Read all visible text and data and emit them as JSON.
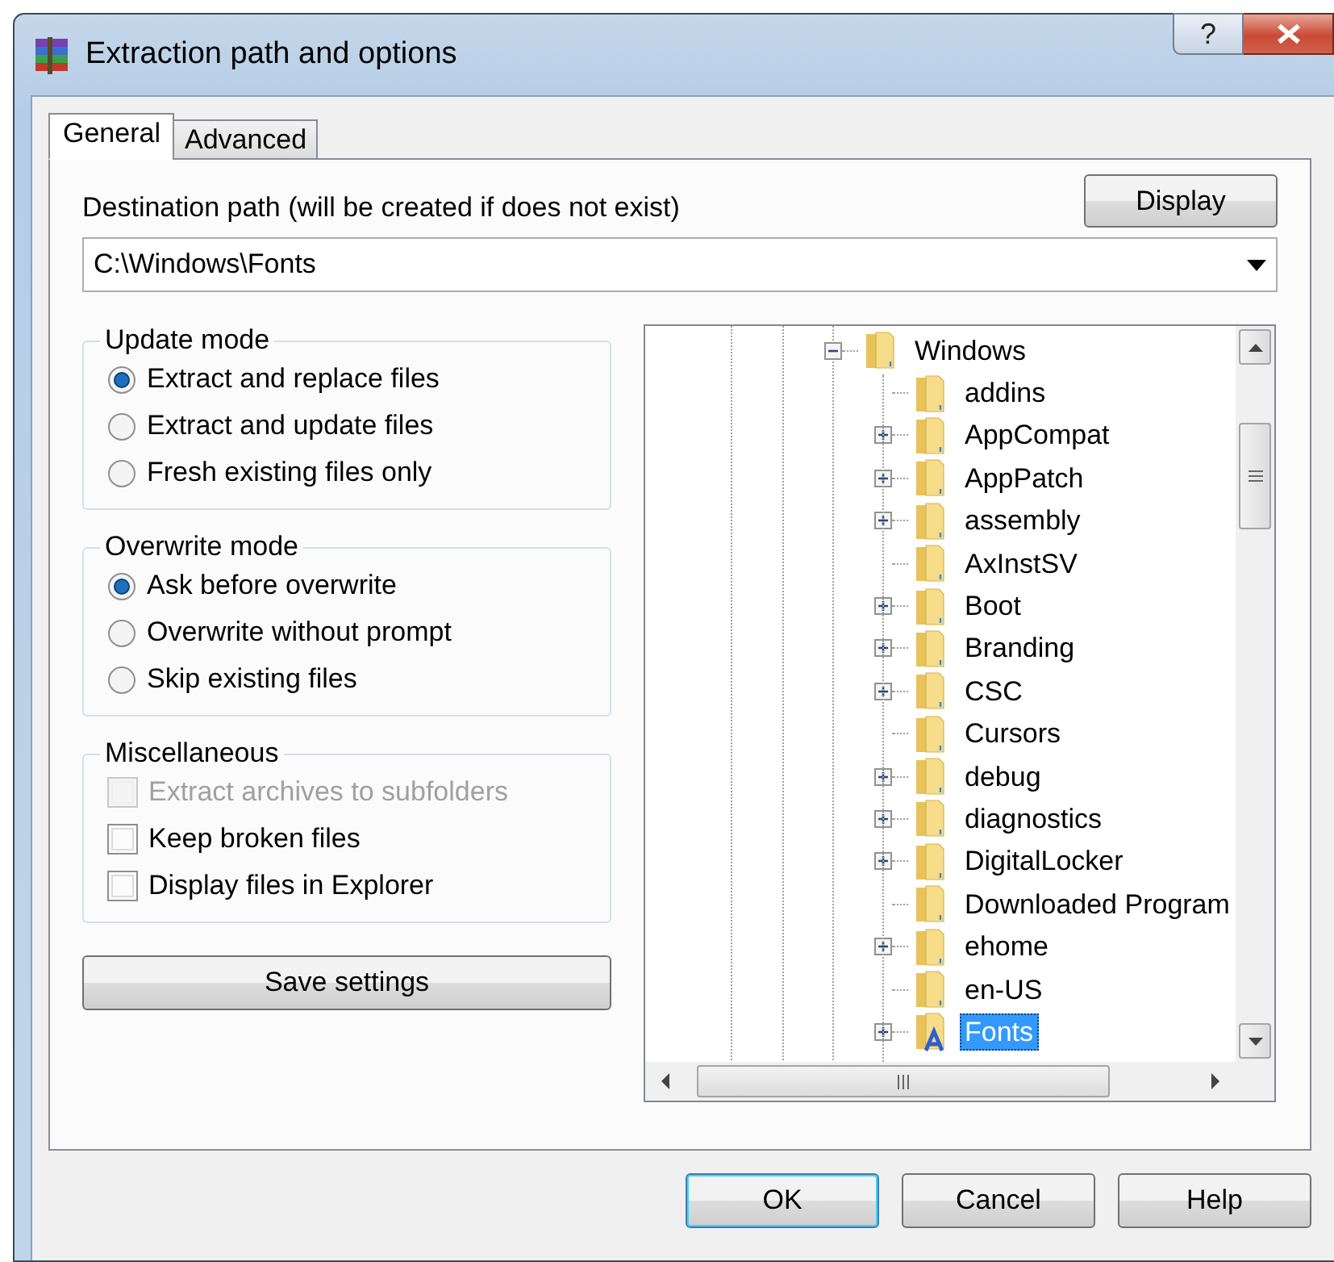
{
  "window": {
    "title": "Extraction path and options",
    "help_glyph": "?"
  },
  "tabs": [
    {
      "label": "General",
      "selected": true
    },
    {
      "label": "Advanced",
      "selected": false
    }
  ],
  "destination": {
    "label": "Destination path (will be created if does not exist)",
    "value": "C:\\Windows\\Fonts",
    "button": "Display"
  },
  "groups": [
    {
      "title": "Update mode",
      "kind": "radio",
      "options": [
        {
          "label": "Extract and replace files",
          "selected": true
        },
        {
          "label": "Extract and update files",
          "selected": false
        },
        {
          "label": "Fresh existing files only",
          "selected": false
        }
      ]
    },
    {
      "title": "Overwrite mode",
      "kind": "radio",
      "options": [
        {
          "label": "Ask before overwrite",
          "selected": true
        },
        {
          "label": "Overwrite without prompt",
          "selected": false
        },
        {
          "label": "Skip existing files",
          "selected": false
        }
      ]
    },
    {
      "title": "Miscellaneous",
      "kind": "checkbox",
      "options": [
        {
          "label": "Extract archives to subfolders",
          "checked": false,
          "disabled": true
        },
        {
          "label": "Keep broken files",
          "checked": false,
          "disabled": false
        },
        {
          "label": "Display files in Explorer",
          "checked": false,
          "disabled": false
        }
      ]
    }
  ],
  "save_button": "Save settings",
  "tree": {
    "nodes": [
      {
        "label": "Windows",
        "kind": "folder",
        "expanded": true,
        "selected": false,
        "children": [
          {
            "label": "addins",
            "kind": "folder",
            "expandable": false,
            "selected": false
          },
          {
            "label": "AppCompat",
            "kind": "folder",
            "expandable": true,
            "selected": false
          },
          {
            "label": "AppPatch",
            "kind": "folder",
            "expandable": true,
            "selected": false
          },
          {
            "label": "assembly",
            "kind": "folder",
            "expandable": true,
            "selected": false
          },
          {
            "label": "AxInstSV",
            "kind": "folder",
            "expandable": false,
            "selected": false
          },
          {
            "label": "Boot",
            "kind": "folder",
            "expandable": true,
            "selected": false
          },
          {
            "label": "Branding",
            "kind": "folder",
            "expandable": true,
            "selected": false
          },
          {
            "label": "CSC",
            "kind": "folder",
            "expandable": true,
            "selected": false
          },
          {
            "label": "Cursors",
            "kind": "folder",
            "expandable": false,
            "selected": false
          },
          {
            "label": "debug",
            "kind": "folder",
            "expandable": true,
            "selected": false
          },
          {
            "label": "diagnostics",
            "kind": "folder",
            "expandable": true,
            "selected": false
          },
          {
            "label": "DigitalLocker",
            "kind": "folder",
            "expandable": true,
            "selected": false
          },
          {
            "label": "Downloaded Program",
            "kind": "folder",
            "expandable": false,
            "selected": false
          },
          {
            "label": "ehome",
            "kind": "folder",
            "expandable": true,
            "selected": false
          },
          {
            "label": "en-US",
            "kind": "folder",
            "expandable": false,
            "selected": false
          },
          {
            "label": "Fonts",
            "kind": "font-folder",
            "expandable": true,
            "selected": true
          }
        ]
      }
    ]
  },
  "buttons": [
    {
      "label": "OK",
      "default": true
    },
    {
      "label": "Cancel",
      "default": false
    },
    {
      "label": "Help",
      "default": false
    }
  ]
}
